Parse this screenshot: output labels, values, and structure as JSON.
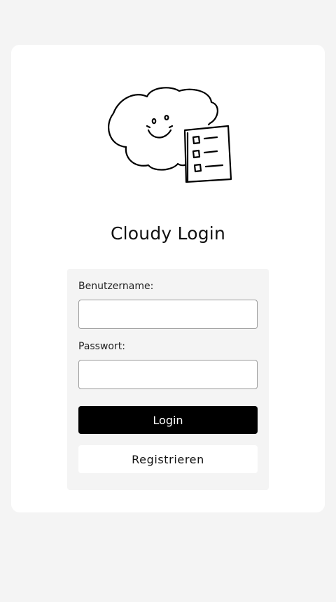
{
  "app": {
    "title": "Cloudy Login",
    "illustration_icon": "cloud-with-checklist-icon"
  },
  "form": {
    "username_label": "Benutzername:",
    "username_value": "",
    "password_label": "Passwort:",
    "password_value": "",
    "login_label": "Login",
    "register_label": "Registrieren"
  },
  "colors": {
    "page_background": "#f4f4f4",
    "card_background": "#ffffff",
    "panel_background": "#f4f4f4",
    "primary_button": "#000000",
    "primary_button_text": "#ffffff"
  }
}
